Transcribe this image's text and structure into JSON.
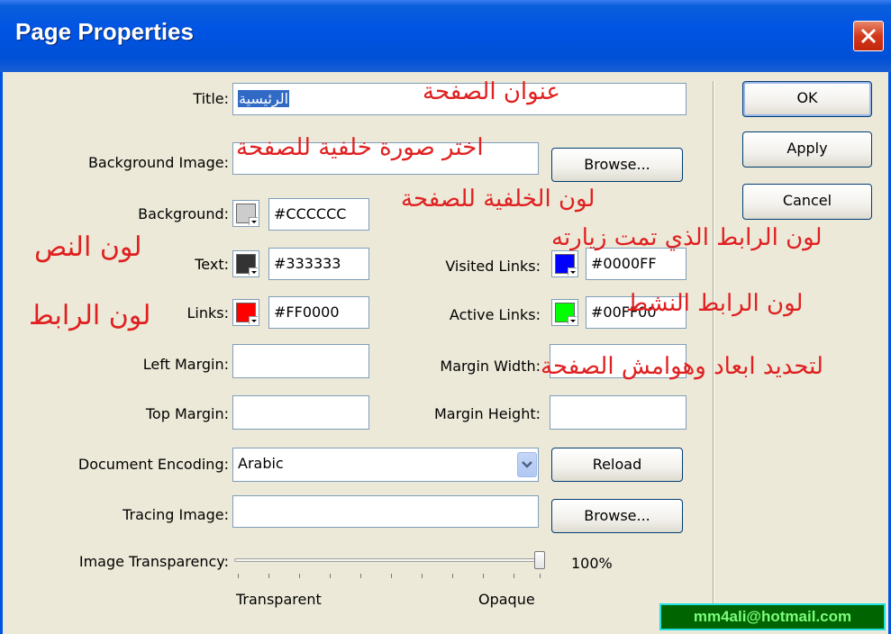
{
  "window": {
    "title": "Page Properties",
    "close_icon": "close-icon"
  },
  "labels": {
    "title": "Title:",
    "background_image": "Background Image:",
    "background": "Background:",
    "text": "Text:",
    "links": "Links:",
    "visited_links": "Visited Links:",
    "active_links": "Active Links:",
    "left_margin": "Left Margin:",
    "top_margin": "Top Margin:",
    "margin_width": "Margin Width:",
    "margin_height": "Margin Height:",
    "document_encoding": "Document Encoding:",
    "tracing_image": "Tracing Image:",
    "image_transparency": "Image Transparency:"
  },
  "fields": {
    "title": "الرئيسية",
    "background_image": "",
    "background": "#CCCCCC",
    "text": "#333333",
    "links": "#FF0000",
    "visited_links": "#0000FF",
    "active_links": "#00FF00",
    "left_margin": "",
    "top_margin": "",
    "margin_width": "",
    "margin_height": "",
    "document_encoding": "Arabic",
    "tracing_image": ""
  },
  "swatch_colors": {
    "background": "#CCCCCC",
    "text": "#333333",
    "links": "#FF0000",
    "visited_links": "#0000FF",
    "active_links": "#00FF00"
  },
  "buttons": {
    "ok": "OK",
    "apply": "Apply",
    "cancel": "Cancel",
    "browse_background": "Browse...",
    "reload": "Reload",
    "browse_tracing": "Browse..."
  },
  "transparency": {
    "value": "100%",
    "level": 1.0,
    "min_label": "Transparent",
    "max_label": "Opaque"
  },
  "annotations": {
    "title": "عنوان الصفحة",
    "background_image": "اختر صورة خلفية للصفحة",
    "background_color": "لون الخلفية للصفحة",
    "text_color": "لون النص",
    "link_color": "لون الرابط",
    "visited_links": "لون الرابط الذي تمت زيارته",
    "active_links": "لون الرابط النشط",
    "margins": "لتحديد ابعاد وهوامش الصفحة"
  },
  "watermark": "mm4ali@hotmail.com",
  "colors": {
    "titlebar": "#0054E3",
    "dialog_bg": "#ECE9D8",
    "annotation": "#E02020"
  }
}
